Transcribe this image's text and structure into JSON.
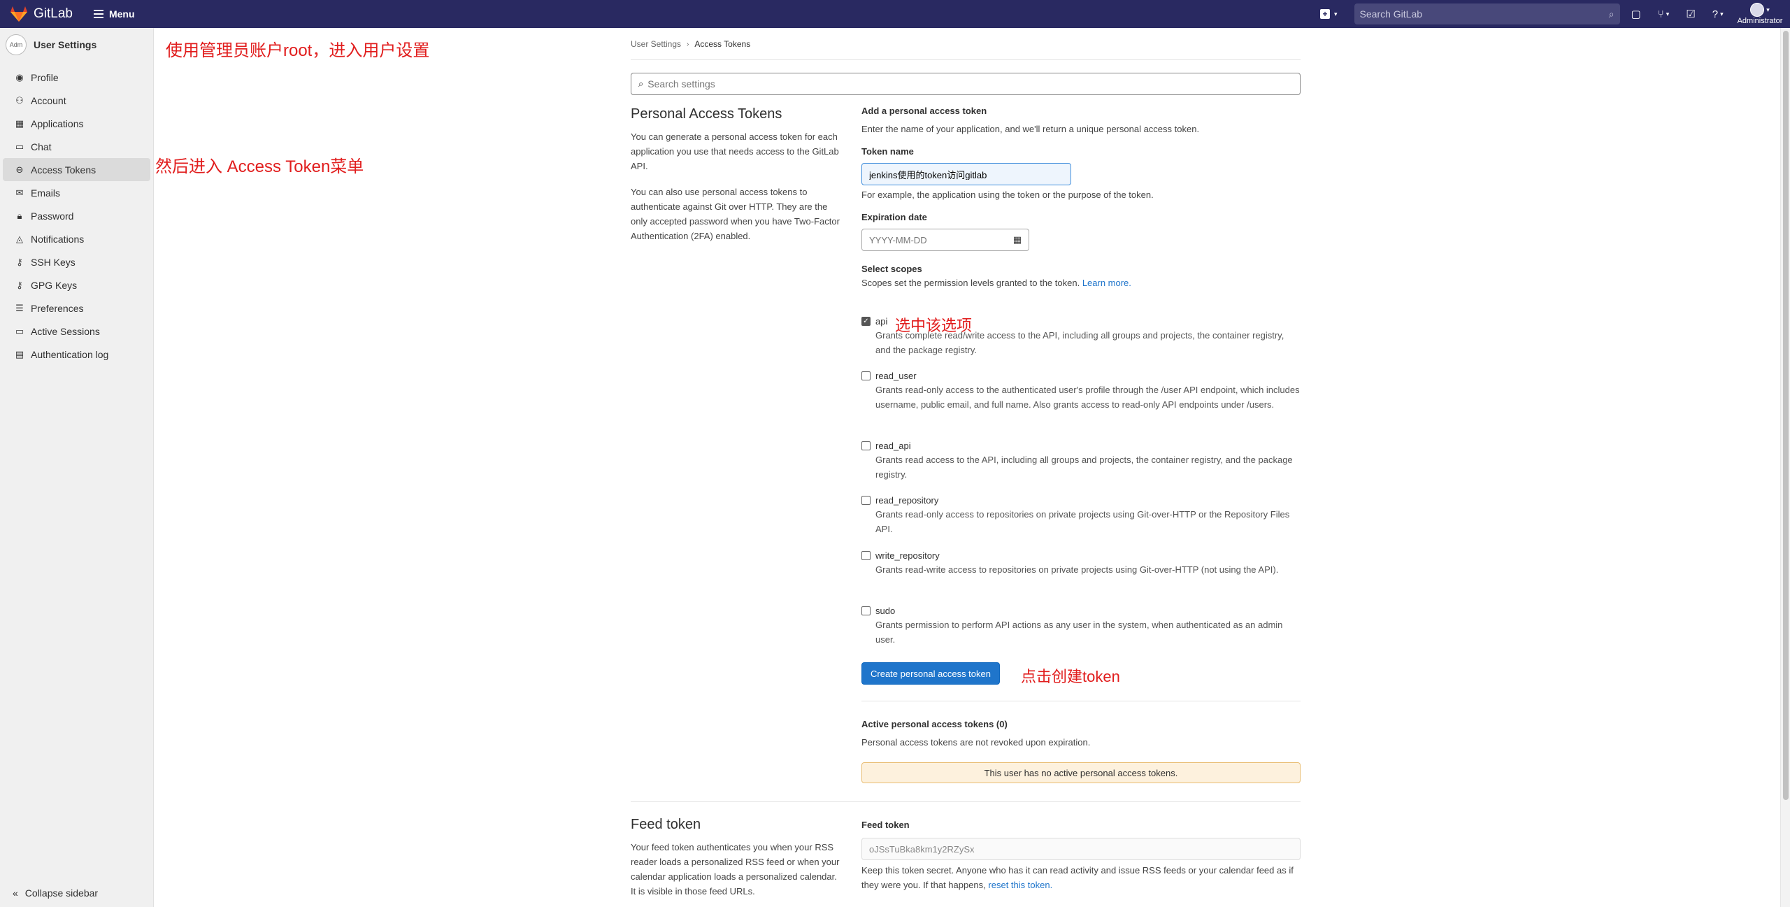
{
  "navbar": {
    "brand": "GitLab",
    "menu_label": "Menu",
    "search_placeholder": "Search GitLab",
    "username": "Administrator"
  },
  "sidebar": {
    "avatar_text": "Adm",
    "title": "User Settings",
    "items": [
      {
        "label": "Profile",
        "icon": "profile-icon",
        "active": false
      },
      {
        "label": "Account",
        "icon": "account-icon",
        "active": false
      },
      {
        "label": "Applications",
        "icon": "applications-icon",
        "active": false
      },
      {
        "label": "Chat",
        "icon": "chat-icon",
        "active": false
      },
      {
        "label": "Access Tokens",
        "icon": "token-icon",
        "active": true
      },
      {
        "label": "Emails",
        "icon": "email-icon",
        "active": false
      },
      {
        "label": "Password",
        "icon": "lock-icon",
        "active": false
      },
      {
        "label": "Notifications",
        "icon": "bell-icon",
        "active": false
      },
      {
        "label": "SSH Keys",
        "icon": "key-icon",
        "active": false
      },
      {
        "label": "GPG Keys",
        "icon": "key-icon",
        "active": false
      },
      {
        "label": "Preferences",
        "icon": "preferences-icon",
        "active": false
      },
      {
        "label": "Active Sessions",
        "icon": "monitor-icon",
        "active": false
      },
      {
        "label": "Authentication log",
        "icon": "log-icon",
        "active": false
      }
    ],
    "collapse_label": "Collapse sidebar"
  },
  "annotations": {
    "a1": "使用管理员账户root，进入用户设置",
    "a2": "然后进入 Access Token菜单",
    "a3": "选中该选项",
    "a4": "点击创建token"
  },
  "breadcrumb": {
    "parent": "User Settings",
    "current": "Access Tokens"
  },
  "search_settings_placeholder": "Search settings",
  "pat": {
    "title": "Personal Access Tokens",
    "desc1": "You can generate a personal access token for each application you use that needs access to the GitLab API.",
    "desc2": "You can also use personal access tokens to authenticate against Git over HTTP. They are the only accepted password when you have Two-Factor Authentication (2FA) enabled."
  },
  "form": {
    "heading": "Add a personal access token",
    "intro": "Enter the name of your application, and we'll return a unique personal access token.",
    "token_name_label": "Token name",
    "token_name_value": "jenkins使用的token访问gitlab",
    "token_name_help": "For example, the application using the token or the purpose of the token.",
    "expiration_label": "Expiration date",
    "expiration_placeholder": "YYYY-MM-DD",
    "scopes_label": "Select scopes",
    "scopes_help": "Scopes set the permission levels granted to the token.",
    "learn_more": "Learn more.",
    "create_button": "Create personal access token"
  },
  "scopes": [
    {
      "name": "api",
      "checked": true,
      "desc": "Grants complete read/write access to the API, including all groups and projects, the container registry, and the package registry."
    },
    {
      "name": "read_user",
      "checked": false,
      "desc": "Grants read-only access to the authenticated user's profile through the /user API endpoint, which includes username, public email, and full name. Also grants access to read-only API endpoints under /users."
    },
    {
      "name": "read_api",
      "checked": false,
      "desc": "Grants read access to the API, including all groups and projects, the container registry, and the package registry."
    },
    {
      "name": "read_repository",
      "checked": false,
      "desc": "Grants read-only access to repositories on private projects using Git-over-HTTP or the Repository Files API."
    },
    {
      "name": "write_repository",
      "checked": false,
      "desc": "Grants read-write access to repositories on private projects using Git-over-HTTP (not using the API)."
    },
    {
      "name": "sudo",
      "checked": false,
      "desc": "Grants permission to perform API actions as any user in the system, when authenticated as an admin user."
    }
  ],
  "active_tokens": {
    "heading": "Active personal access tokens (0)",
    "subtext": "Personal access tokens are not revoked upon expiration.",
    "empty_notice": "This user has no active personal access tokens."
  },
  "feed": {
    "title": "Feed token",
    "desc": "Your feed token authenticates you when your RSS reader loads a personalized RSS feed or when your calendar application loads a personalized calendar. It is visible in those feed URLs.",
    "label": "Feed token",
    "value": "oJSsTuBka8km1y2RZySx",
    "help": "Keep this token secret. Anyone who has it can read activity and issue RSS feeds or your calendar feed as if they were you. If that happens,",
    "reset_link": "reset this token."
  }
}
